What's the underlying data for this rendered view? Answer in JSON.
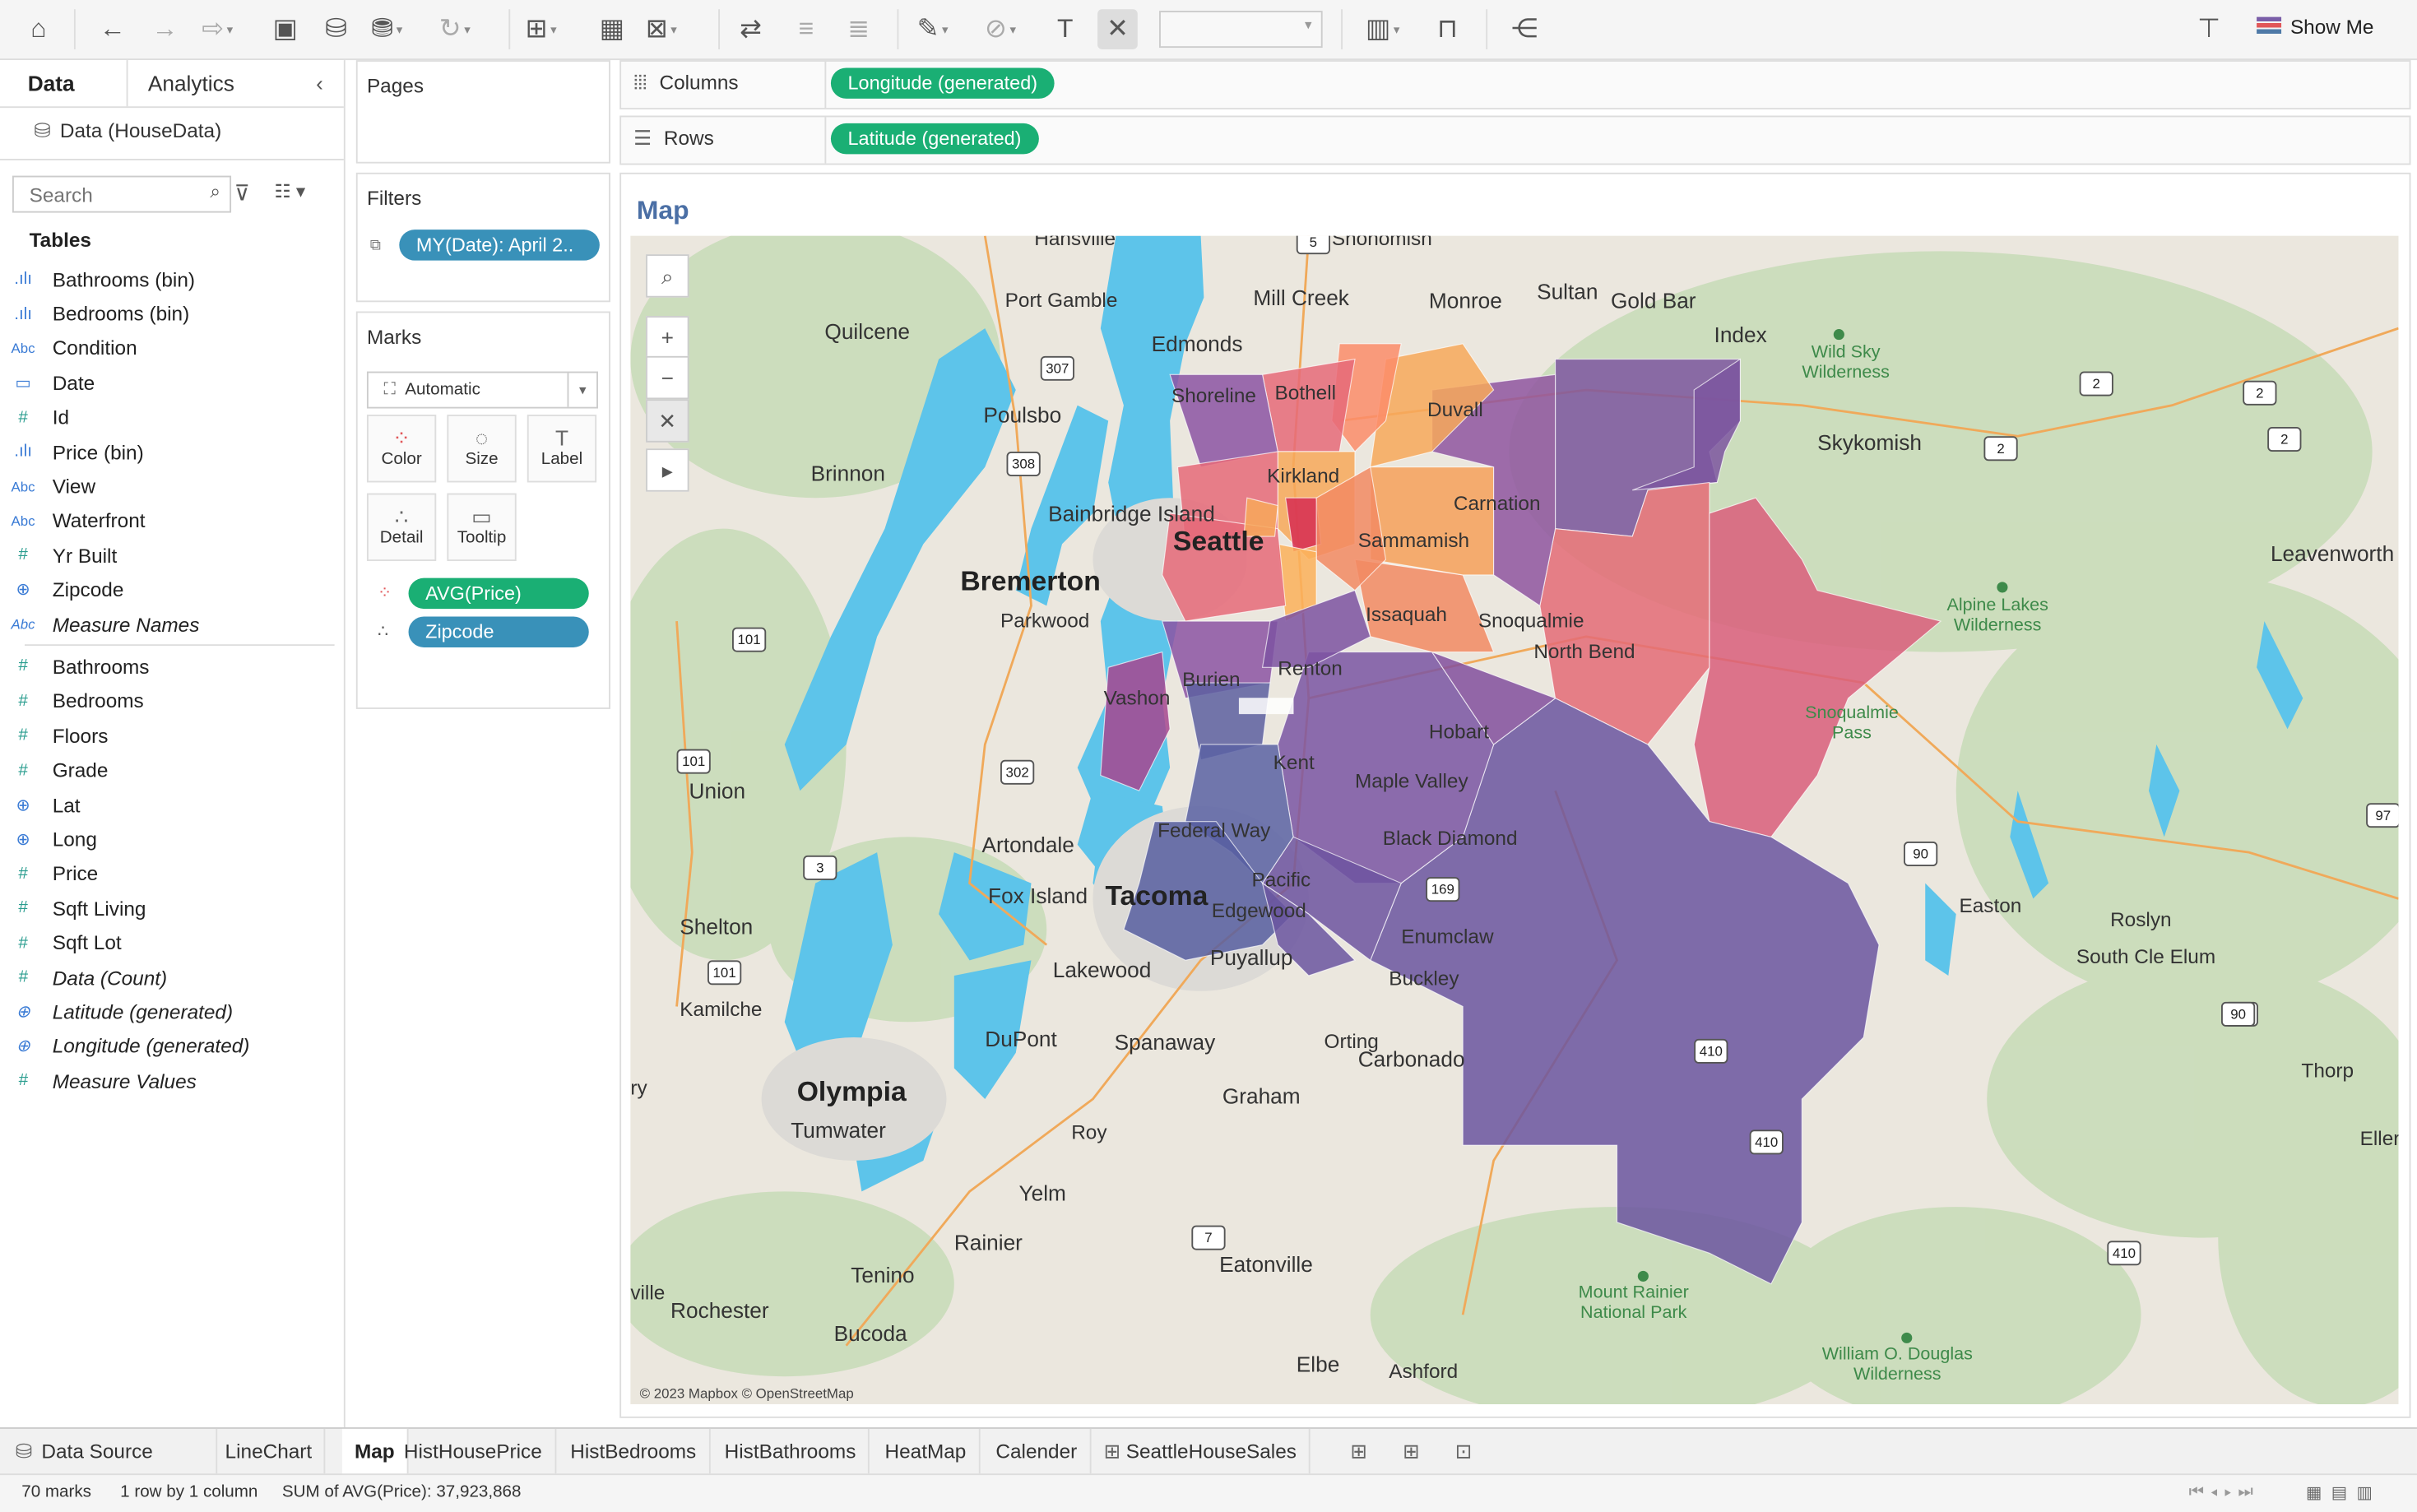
{
  "toolbar": {
    "show_me": "Show Me"
  },
  "left_panel": {
    "tab_data": "Data",
    "tab_analytics": "Analytics",
    "datasource": "Data (HouseData)",
    "search_placeholder": "Search",
    "tables_heading": "Tables",
    "fields_top": [
      {
        "icon": "bin",
        "name": "Bathrooms (bin)"
      },
      {
        "icon": "bin",
        "name": "Bedrooms (bin)"
      },
      {
        "icon": "abc",
        "name": "Condition"
      },
      {
        "icon": "date",
        "name": "Date"
      },
      {
        "icon": "hash",
        "name": "Id"
      },
      {
        "icon": "bin",
        "name": "Price (bin)"
      },
      {
        "icon": "abc",
        "name": "View"
      },
      {
        "icon": "abc",
        "name": "Waterfront"
      },
      {
        "icon": "hash",
        "name": "Yr Built"
      },
      {
        "icon": "globe",
        "name": "Zipcode"
      },
      {
        "icon": "abc",
        "name": "Measure Names"
      }
    ],
    "fields_bottom": [
      {
        "icon": "hash",
        "name": "Bathrooms"
      },
      {
        "icon": "hash",
        "name": "Bedrooms"
      },
      {
        "icon": "hash",
        "name": "Floors"
      },
      {
        "icon": "hash",
        "name": "Grade"
      },
      {
        "icon": "globe",
        "name": "Lat"
      },
      {
        "icon": "globe",
        "name": "Long"
      },
      {
        "icon": "hash",
        "name": "Price"
      },
      {
        "icon": "hash",
        "name": "Sqft Living"
      },
      {
        "icon": "hash",
        "name": "Sqft Lot"
      },
      {
        "icon": "hash",
        "name": "Data (Count)"
      },
      {
        "icon": "globe",
        "name": "Latitude (generated)"
      },
      {
        "icon": "globe",
        "name": "Longitude (generated)"
      },
      {
        "icon": "hash",
        "name": "Measure Values"
      }
    ]
  },
  "cards": {
    "pages": "Pages",
    "filters": "Filters",
    "filter_pill": "MY(Date): April 2..",
    "marks": "Marks",
    "mark_type": "Automatic",
    "btn_color": "Color",
    "btn_size": "Size",
    "btn_label": "Label",
    "btn_detail": "Detail",
    "btn_tooltip": "Tooltip",
    "pill_color": "AVG(Price)",
    "pill_detail": "Zipcode"
  },
  "shelves": {
    "columns_label": "Columns",
    "columns_pill": "Longitude (generated)",
    "rows_label": "Rows",
    "rows_pill": "Latitude (generated)"
  },
  "view": {
    "title": "Map",
    "attribution": "© 2023 Mapbox © OpenStreetMap"
  },
  "map_labels": {
    "hansville": "Hansville",
    "snohomish": "Snohomish",
    "port_gamble": "Port Gamble",
    "mill_creek": "Mill Creek",
    "monroe": "Monroe",
    "sultan": "Sultan",
    "gold_bar": "Gold Bar",
    "quilcene": "Quilcene",
    "edmonds": "Edmonds",
    "index": "Index",
    "wild_sky": "Wild Sky\nWilderness",
    "poulsbo": "Poulsbo",
    "shoreline": "Shoreline",
    "bothell": "Bothell",
    "duvall": "Duvall",
    "brinnon": "Brinnon",
    "skykomish": "Skykomish",
    "kirkland": "Kirkland",
    "bainbridge": "Bainbridge\nIsland",
    "seattle": "Seattle",
    "carnation": "Carnation",
    "sammamish": "Sammamish",
    "leavenworth": "Leavenworth",
    "bremerton": "Bremerton",
    "parkwood": "Parkwood",
    "issaquah": "Issaquah",
    "snoqualmie": "Snoqualmie",
    "alpine": "Alpine Lakes\nWilderness",
    "north_bend": "North Bend",
    "renton": "Renton",
    "burien": "Burien",
    "vashon": "Vashon",
    "snoqualmie_pass": "Snoqualmie\nPass",
    "hobart": "Hobart",
    "union": "Union",
    "kent": "Kent",
    "maple_valley": "Maple Valley",
    "federal_way": "Federal Way",
    "black_diamond": "Black Diamond",
    "artondale": "Artondale",
    "fox_island": "Fox Island",
    "tacoma": "Tacoma",
    "edgewood": "Edgewood",
    "pacific": "Pacific",
    "easton": "Easton",
    "roslyn": "Roslyn",
    "shelton": "Shelton",
    "enumclaw": "Enumclaw",
    "south_cle_elum": "South Cle Elum",
    "puyallup": "Puyallup",
    "lakewood": "Lakewood",
    "buckley": "Buckley",
    "kamilche": "Kamilche",
    "dupont": "DuPont",
    "spanaway": "Spanaway",
    "orting": "Orting",
    "carbonado": "Carbonado",
    "thorp": "Thorp",
    "olympia": "Olympia",
    "tumwater": "Tumwater",
    "graham": "Graham",
    "roy": "Roy",
    "eller": "Eller",
    "yelm": "Yelm",
    "rainier": "Rainier",
    "tenino": "Tenino",
    "eatonville": "Eatonville",
    "ville": "ville",
    "rochester": "Rochester",
    "mount_rainier": "Mount Rainier\nNational Park",
    "bucoda": "Bucoda",
    "elbe": "Elbe",
    "ashford": "Ashford",
    "william": "William O. Douglas\nWilderness",
    "ry": "ry"
  },
  "route_shields": [
    "5",
    "307",
    "308",
    "2",
    "2",
    "2",
    "2",
    "101",
    "101",
    "302",
    "3",
    "90",
    "90",
    "169",
    "97",
    "101",
    "410",
    "410",
    "7",
    "410",
    "90"
  ],
  "sheets": {
    "data_source": "Data Source",
    "tabs": [
      "LineChart",
      "Map",
      "HistHousePrice",
      "HistBedrooms",
      "HistBathrooms",
      "HeatMap",
      "Calender",
      "SeattleHouseSales"
    ],
    "active": "Map"
  },
  "status": {
    "marks": "70 marks",
    "rows": "1 row by 1 column",
    "sum": "SUM of AVG(Price): 37,923,868"
  },
  "colors": {
    "pill_green": "#1aaf74",
    "pill_blue": "#3991b9",
    "water": "#5dc4ea",
    "title_blue": "#4b6fa5"
  }
}
